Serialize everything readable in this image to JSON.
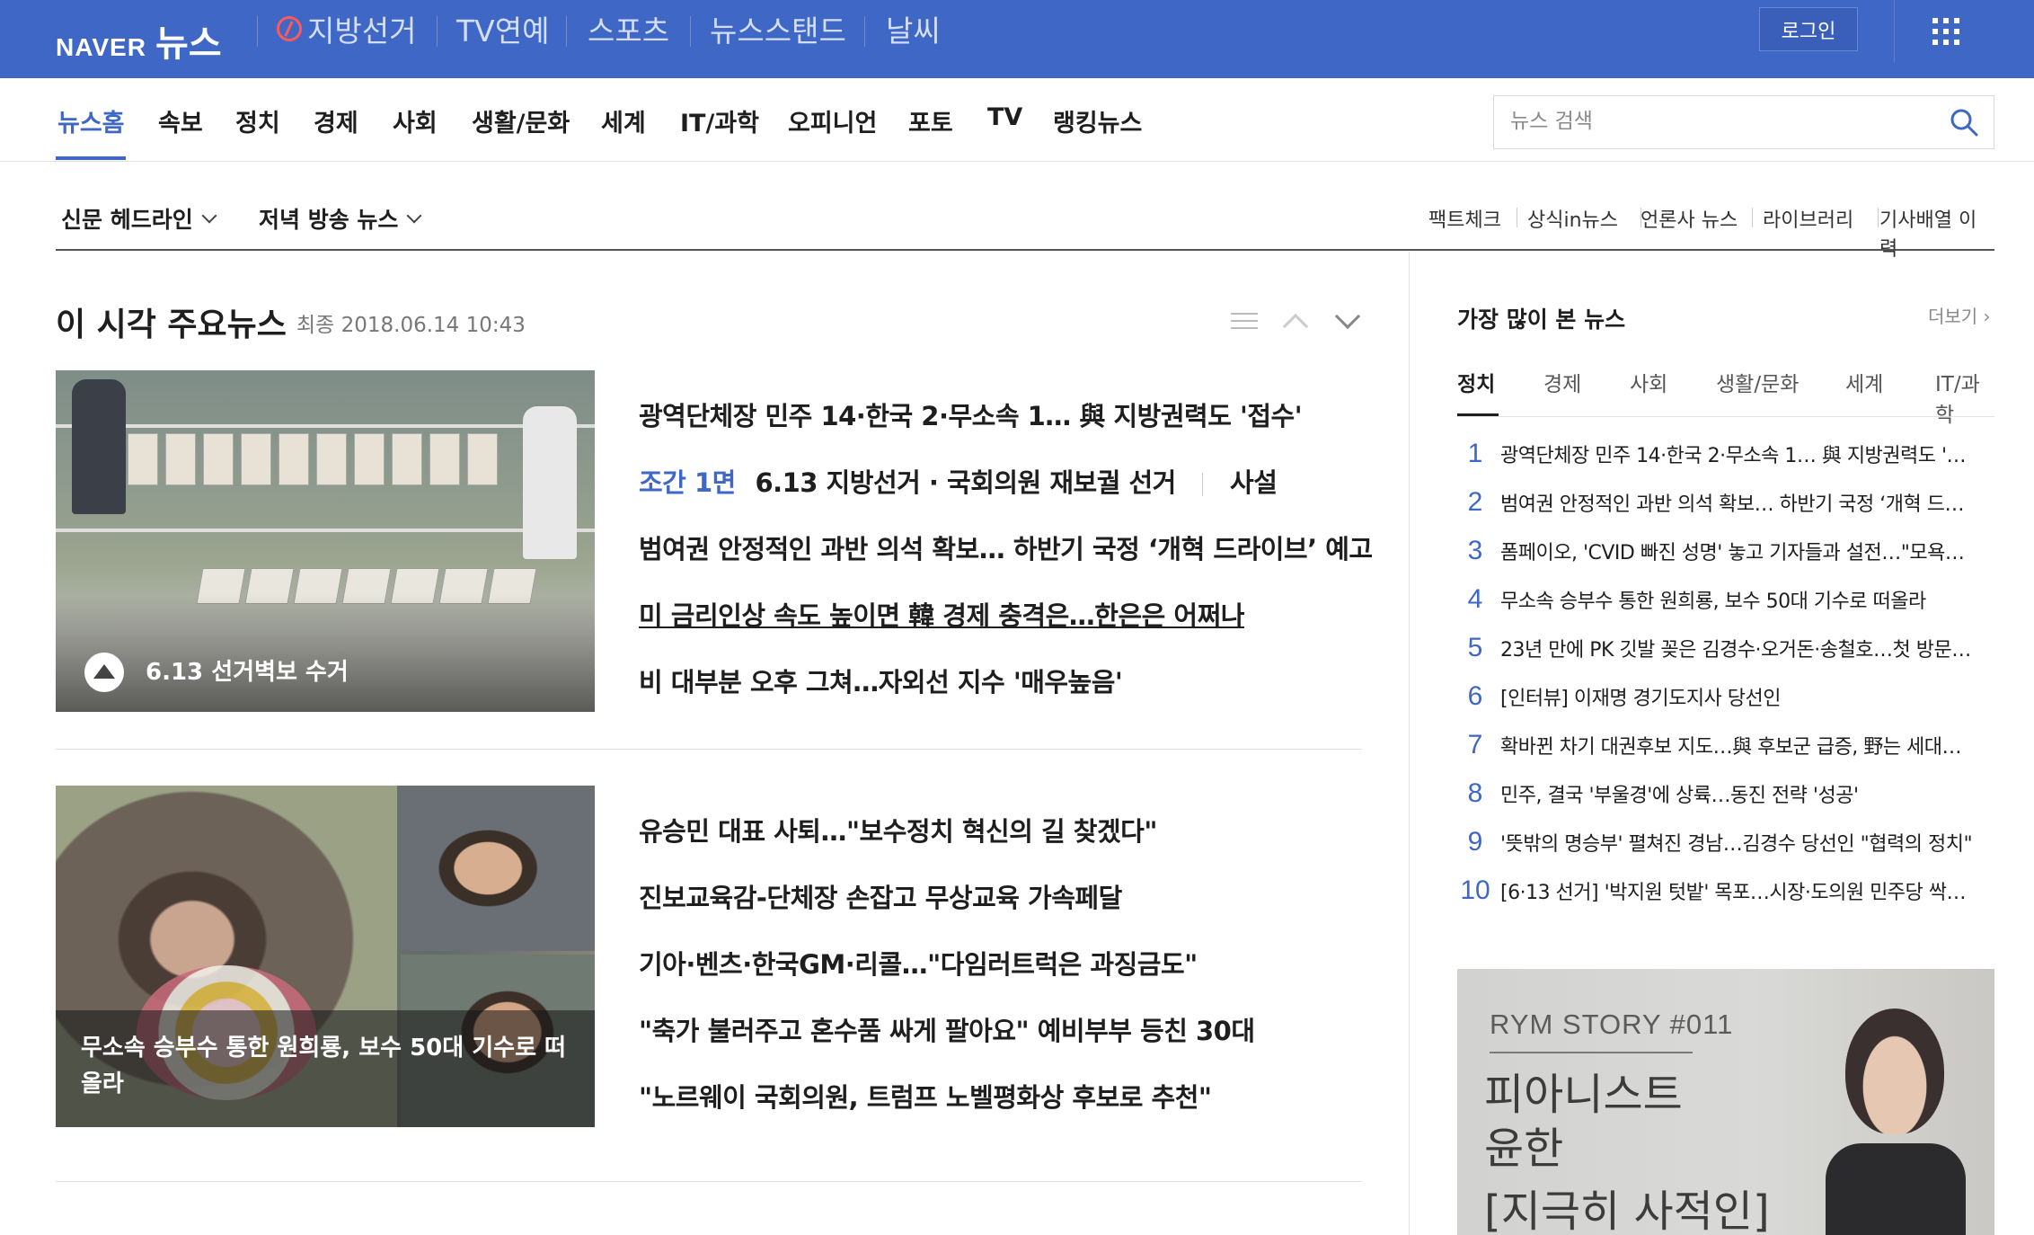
{
  "header": {
    "logo_naver": "NAVER",
    "logo_news": "뉴스",
    "services": [
      "지방선거",
      "TV연예",
      "스포츠",
      "뉴스스탠드",
      "날씨"
    ],
    "login_label": "로그인",
    "accent": "#3f67c5"
  },
  "nav": {
    "items": [
      "뉴스홈",
      "속보",
      "정치",
      "경제",
      "사회",
      "생활/문화",
      "세계",
      "IT/과학",
      "오피니언",
      "포토",
      "TV",
      "랭킹뉴스"
    ],
    "active": "뉴스홈",
    "search_placeholder": "뉴스 검색"
  },
  "subnav": {
    "left": [
      "신문 헤드라인",
      "저녁 방송 뉴스"
    ],
    "right": [
      "팩트체크",
      "상식in뉴스",
      "언론사 뉴스",
      "라이브러리",
      "기사배열 이력"
    ]
  },
  "main": {
    "title": "이 시각 주요뉴스",
    "updated": "최종 2018.06.14 10:43",
    "block1": {
      "thumb_caption": "6.13 선거벽보 수거",
      "headlines": [
        "광역단체장 민주 14·한국 2·무소속 1… 與 지방권력도 '접수'",
        "범여권 안정적인 과반 의석 확보… 하반기 국정 ‘개혁 드라이브’ 예고",
        "미 금리인상 속도 높이면 韓 경제 충격은…한은은 어쩌나",
        "비 대부분 오후 그쳐…자외선 지수 '매우높음'"
      ],
      "tag_line": {
        "tag": "조간 1면",
        "text": "6.13 지방선거 · 국회의원 재보궐 선거",
        "extra": "사설"
      }
    },
    "block2": {
      "thumb_caption": "무소속 승부수 통한 원희룡, 보수 50대 기수로 떠올라",
      "headlines": [
        "유승민 대표 사퇴…\"보수정치 혁신의 길 찾겠다\"",
        "진보교육감-단체장 손잡고 무상교육 가속페달",
        "기아·벤츠·한국GM·리콜…\"다임러트럭은 과징금도\"",
        "\"축가 불러주고 혼수품 싸게 팔아요\" 예비부부 등친 30대",
        "\"노르웨이 국회의원, 트럼프 노벨평화상 후보로 추천\""
      ]
    }
  },
  "ranking": {
    "title": "가장 많이 본 뉴스",
    "more": "더보기",
    "tabs": [
      "정치",
      "경제",
      "사회",
      "생활/문화",
      "세계",
      "IT/과학"
    ],
    "active_tab": "정치",
    "items": [
      {
        "num": "1",
        "text": "광역단체장 민주 14·한국 2·무소속 1… 與 지방권력도 '…"
      },
      {
        "num": "2",
        "text": "범여권 안정적인 과반 의석 확보… 하반기 국정 ‘개혁 드…"
      },
      {
        "num": "3",
        "text": "폼페이오, 'CVID 빠진 성명' 놓고 기자들과 설전…\"모욕…"
      },
      {
        "num": "4",
        "text": "무소속 승부수 통한 원희룡, 보수 50대 기수로 떠올라"
      },
      {
        "num": "5",
        "text": "23년 만에 PK 깃발 꽂은 김경수·오거돈·송철호…첫 방문…"
      },
      {
        "num": "6",
        "text": "[인터뷰] 이재명 경기도지사 당선인"
      },
      {
        "num": "7",
        "text": "확바뀐 차기 대권후보 지도…與 후보군 급증, 野는 세대…"
      },
      {
        "num": "8",
        "text": "민주, 결국 '부울경'에 상륙…동진 전략 '성공'"
      },
      {
        "num": "9",
        "text": "'뜻밖의 명승부' 펼쳐진 경남…김경수 당선인 \"협력의 정치\""
      },
      {
        "num": "10",
        "text": "[6·13 선거] '박지원 텃밭' 목포…시장·도의원 민주당 싹…"
      }
    ]
  },
  "ad": {
    "code": "RYM STORY #011",
    "name_line1": "피아니스트",
    "name_line2": "윤한",
    "sub": "[지극히 사적인]"
  }
}
